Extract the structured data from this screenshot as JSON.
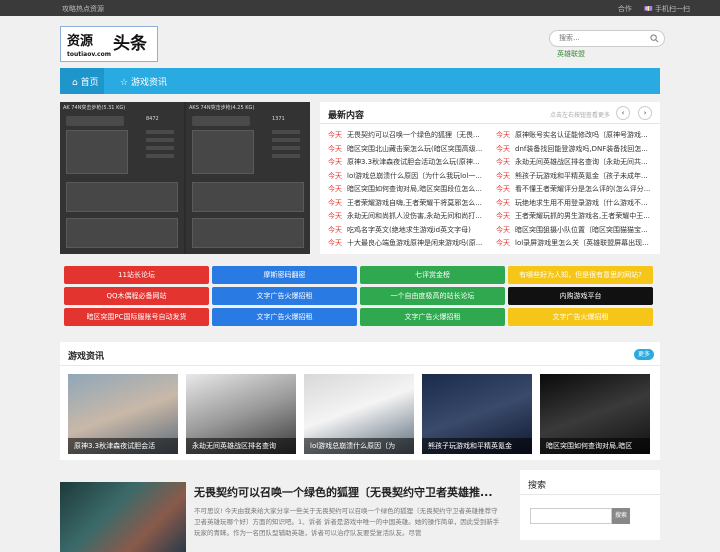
{
  "topbar": {
    "left": "攻略热点资源",
    "links": [
      "合作",
      "💷 手机扫一扫"
    ]
  },
  "logo": {
    "part1": "资源",
    "part2": "头条",
    "domain": "toutiaov.com"
  },
  "search": {
    "placeholder": "搜索...",
    "hotword": "英雄联盟"
  },
  "nav": {
    "home": "首页",
    "games": "游戏资讯"
  },
  "slider": {
    "left_caption": "AK 74N突击步枪(5.31 KG)",
    "right_caption": "AKS 74N突击步枪(4.25 KG)",
    "stat_left": "8472",
    "stat_right": "1371"
  },
  "latest": {
    "title": "最新内容",
    "hint": "点击左右按钮查看更多",
    "prev": "‹",
    "next": "›",
    "tag": "今天",
    "left": [
      "无畏契约可以召唤一个绿色的狐狸〔无畏...",
      "暗区突围北山藏击案怎么玩(暗区突围高级...",
      "原神3.3秋津森夜试胆会活动怎么玩(原神...",
      "lol游戏总崩溃什么原因〔为什么我玩lol一...",
      "暗区突围如何查询对局,暗区突围段位怎么...",
      "王者荣耀游戏自嗨,王者荣耀干将莫邪怎么...",
      "永劫无间和尚抓人没伤害,永劫无间和尚打...",
      "吃鸡名字英文(绝地求生游戏id英文字母)",
      "十大最良心端鱼游戏原神是闲来游戏吗(原..."
    ],
    "right": [
      "原神账号实名认证能修改吗〔原神号游戏...",
      "dnf装备找回能登游戏吗,DNF装备找回怎...",
      "永劫无间英雄战区排名查询〔永劫无间共...",
      "熊孩子玩游戏和平精英氪金〔孩子未成年...",
      "看不懂王者荣耀评分是怎么评的(怎么评分...",
      "玩绝地求生用不用登录游戏〔什么游戏不...",
      "王者荣耀玩抓的男生游戏名,王者荣耀中王...",
      "暗区突围狙摄小队位置〔暗区突围猫猫宝...",
      "lol录屏游戏里怎么关〔英雄联盟屏幕出现..."
    ]
  },
  "tiles": [
    {
      "label": "11站长论坛",
      "color": "#e3342f"
    },
    {
      "label": "摩斯密码翻密",
      "color": "#2a7ae4"
    },
    {
      "label": "七评赏金榜",
      "color": "#2fa84f"
    },
    {
      "label": "有哪些好为人知，但是很有意思的网站?",
      "color": "#f5c518"
    },
    {
      "label": "QQ木偶程必备网站",
      "color": "#e3342f"
    },
    {
      "label": "文字广告火爆招租",
      "color": "#2a7ae4"
    },
    {
      "label": "一个自由度极高的站长论坛",
      "color": "#2fa84f"
    },
    {
      "label": "内购游戏平台",
      "color": "#111111"
    },
    {
      "label": "暗区突围PC国际服账号自动发货",
      "color": "#e3342f"
    },
    {
      "label": "文字广告火爆招租",
      "color": "#2a7ae4"
    },
    {
      "label": "文字广告火爆招租",
      "color": "#2fa84f"
    },
    {
      "label": "文字广告火爆招租",
      "color": "#f5c518"
    }
  ],
  "games": {
    "title": "游戏资讯",
    "more": "更多",
    "cards": [
      {
        "caption": "原神3.3秋津森夜试胆会活",
        "bg": "linear-gradient(160deg,#8fa7b8,#c9b8a8 50%,#5a6a7a)"
      },
      {
        "caption": "永劫无间英雄战区排名查询",
        "bg": "linear-gradient(160deg,#e8e8e8,#9a9a9a 50%,#3a3a3a)"
      },
      {
        "caption": "lol游戏总崩溃什么原因〔为",
        "bg": "linear-gradient(160deg,#d8d8d8,#f4f4f4 45%,#5a6a7a)"
      },
      {
        "caption": "熊孩子玩游戏和平精英氪金",
        "bg": "linear-gradient(160deg,#1a2a4a,#3a4a6a 50%,#101830)"
      },
      {
        "caption": "暗区突围如何查询对局,暗区",
        "bg": "linear-gradient(160deg,#0a0a0a,#3a3a3a 50%,#111111)"
      }
    ]
  },
  "article": {
    "title": "无畏契约可以召唤一个绿色的狐狸〔无畏契约守卫者英雄推...",
    "excerpt": "不可思议! 今天由我来给大家分享一些关于无畏契约可以召唤一个绿色的狐狸〔无畏契约守卫者英雄推荐守卫者英雄玩哪个好〕方面的知识吧。1、诉者 诉者是游戏中唯一的中国英雄。她的操作简单，因此受到新手玩家的青睐。作为一名团队型辅助英雄，诉者可以治疗队友要受复活队友。尽管"
  },
  "sidebar": {
    "search_title": "搜索",
    "button": "搜索"
  }
}
